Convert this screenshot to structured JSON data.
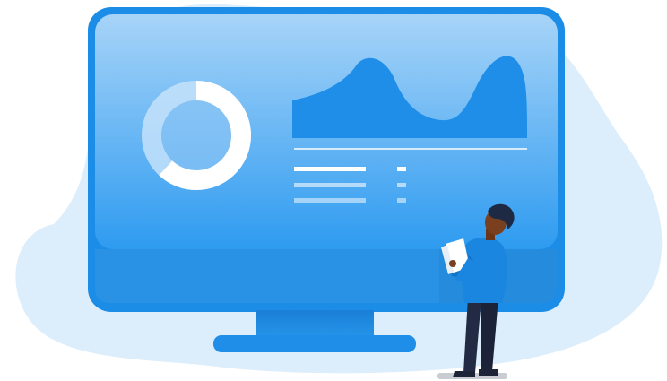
{
  "scene": {
    "description_icon": "dashboard-monitor-illustration",
    "colors": {
      "blob": "#d9ecfb",
      "monitor_frame": "#1c8de6",
      "screen_top": "#9fd0f7",
      "screen_bottom": "#2d9af0",
      "chart_fill": "#1e8ee8",
      "stand": "#1b87df",
      "skin": "#7a3f1f",
      "hair": "#1e2a44",
      "shirt": "#1a86e0",
      "pants": "#232a44",
      "shoes": "#1e2438",
      "paper": "#ffffff",
      "floor": "#c9ccd3"
    },
    "donut": {
      "filled_fraction": 0.62
    },
    "legend_rows": 3
  }
}
